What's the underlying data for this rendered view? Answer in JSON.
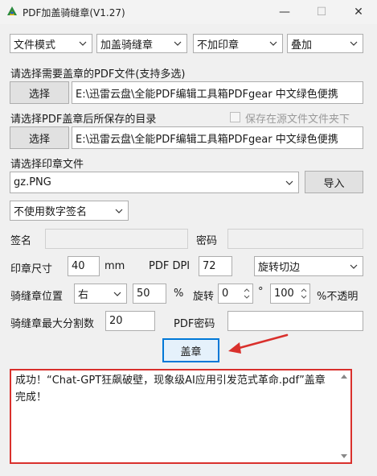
{
  "window": {
    "title": "PDF加盖骑缝章(V1.27)",
    "minimize_glyph": "—",
    "maximize_glyph": "☐",
    "close_glyph": "✕"
  },
  "toolbar": {
    "mode_select": "文件模式",
    "stamp_type_select": "加盖骑缝章",
    "print_select": "不加印章",
    "blend_select": "叠加"
  },
  "source": {
    "label": "请选择需要盖章的PDF文件(支持多选)",
    "button": "选择",
    "path": "E:\\迅雷云盘\\全能PDF编辑工具箱PDFgear 中文绿色便携"
  },
  "output": {
    "label": "请选择PDF盖章后所保存的目录",
    "save_in_source_label": "保存在源文件文件夹下",
    "button": "选择",
    "path": "E:\\迅雷云盘\\全能PDF编辑工具箱PDFgear 中文绿色便携"
  },
  "stamp": {
    "label": "请选择印章文件",
    "file": "gz.PNG",
    "import_button": "导入"
  },
  "signature": {
    "mode": "不使用数字签名",
    "sign_label": "签名",
    "password_label": "密码"
  },
  "params": {
    "size_label": "印章尺寸",
    "size_value": "40",
    "size_unit": "mm",
    "dpi_label": "PDF DPI",
    "dpi_value": "72",
    "rotate_edge": "旋转切边",
    "position_label": "骑缝章位置",
    "position_value": "右",
    "position_percent": "50",
    "percent_sign": "%",
    "rotate_label": "旋转",
    "rotate_value": "0",
    "degree_sign": "°",
    "opacity_value": "100",
    "opacity_label": "%不透明",
    "max_split_label": "骑缝章最大分割数",
    "max_split_value": "20",
    "pdf_password_label": "PDF密码"
  },
  "actions": {
    "stamp_button": "盖章"
  },
  "log": {
    "text": "成功！“Chat-GPT狂飙破壁，现象级AI应用引发范式革命.pdf”盖章完成！"
  },
  "colors": {
    "annotation_red": "#d9302c",
    "focus_blue": "#0078d7"
  }
}
